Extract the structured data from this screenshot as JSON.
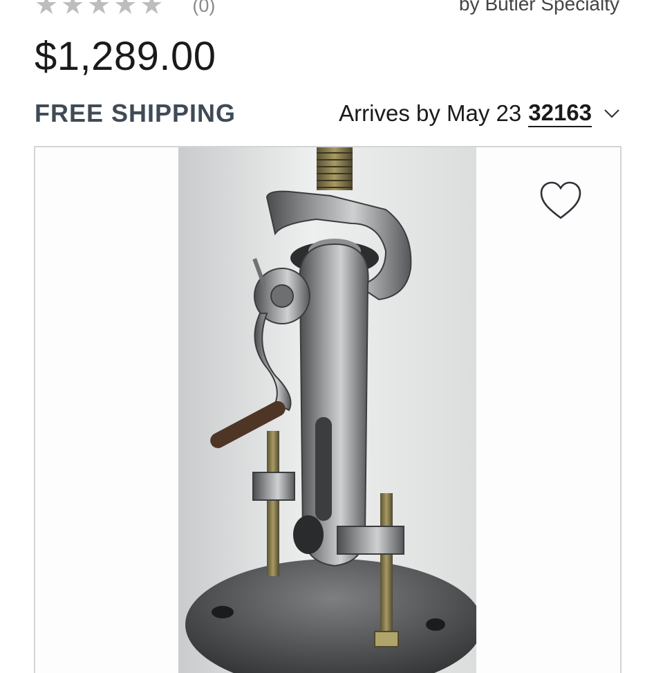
{
  "rating": {
    "stars": 5,
    "count_label": "(0)"
  },
  "brand": {
    "prefix": "by",
    "name": "Butler Specialty"
  },
  "price": "$1,289.00",
  "shipping": {
    "label": "FREE SHIPPING"
  },
  "delivery": {
    "arrives_text": "Arrives by May 23",
    "zip": "32163"
  },
  "icons": {
    "rating": "star-icon",
    "zip_toggle": "chevron-down-icon",
    "favorite": "heart-outline-icon"
  },
  "colors": {
    "shipping_text": "#3f4b56",
    "star_empty": "#bdbdbd",
    "card_border": "#d4d4d4"
  }
}
